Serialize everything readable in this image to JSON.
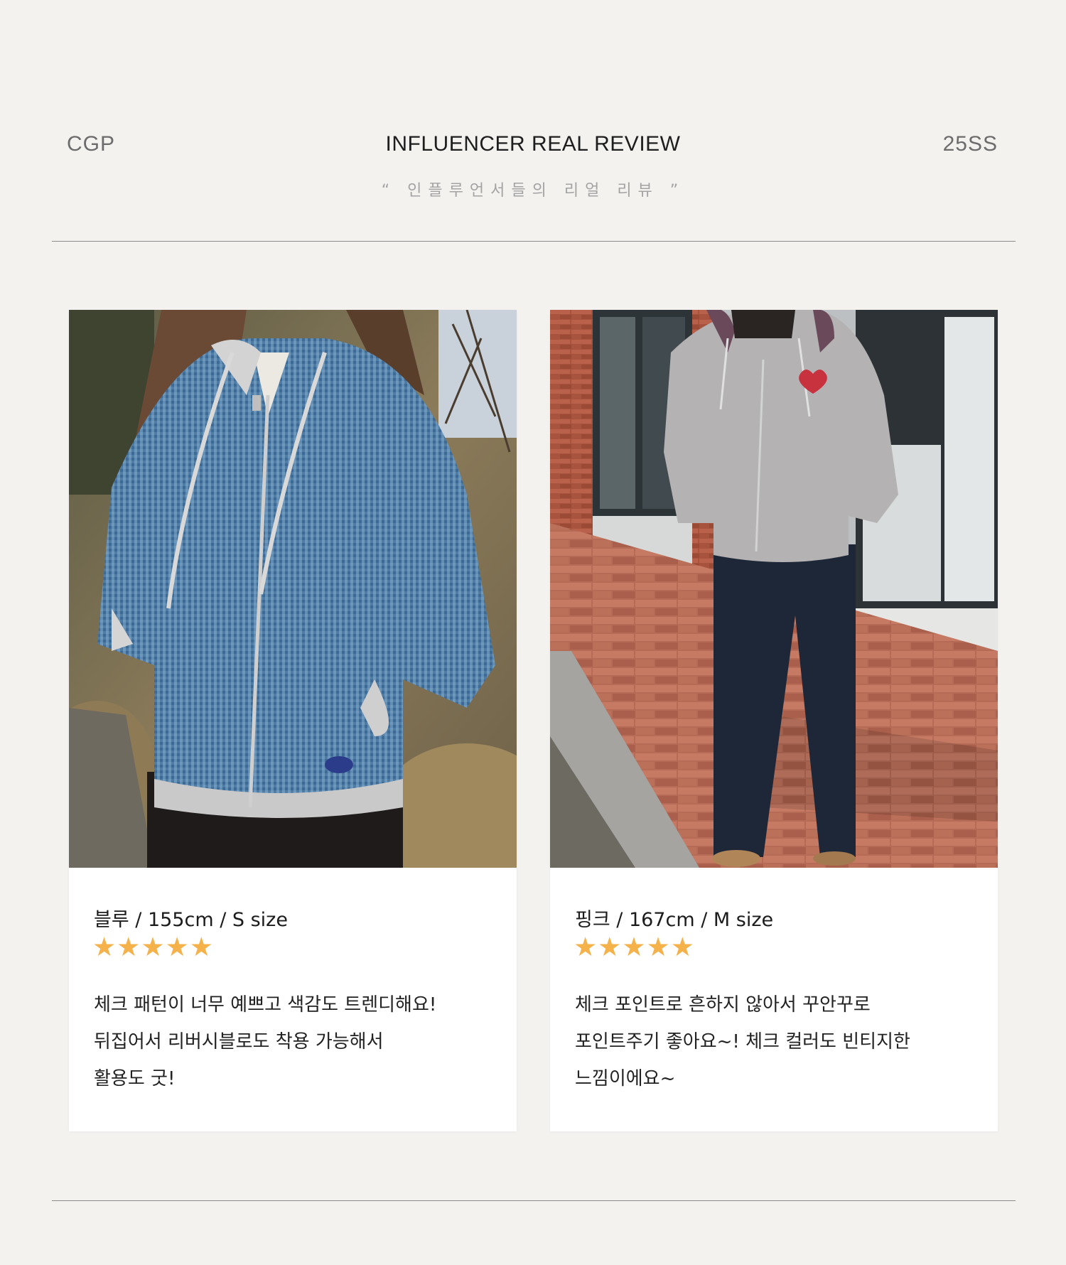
{
  "header": {
    "brand_left": "CGP",
    "title": "INFLUENCER REAL REVIEW",
    "brand_right": "25SS",
    "subtitle": "“ 인플루언서들의 리얼 리뷰 ”"
  },
  "reviews": [
    {
      "photo_alt": "blue gingham reversible zip hoodie worn outdoors",
      "meta": "블루 / 155cm / S size",
      "rating": 5,
      "stars": [
        "★",
        "★",
        "★",
        "★",
        "★"
      ],
      "lines": [
        "체크 패턴이 너무 예쁘고 색감도 트렌디해요!",
        "뒤집어서 리버시블로도 착용 가능해서",
        "활용도 굿!"
      ]
    },
    {
      "photo_alt": "grey zip hoodie with heart patch worn with dark wide jeans on brick sidewalk",
      "meta": "핑크 / 167cm / M size",
      "rating": 5,
      "stars": [
        "★",
        "★",
        "★",
        "★",
        "★"
      ],
      "lines": [
        "체크 포인트로 흔하지 않아서 꾸안꾸로",
        "포인트주기 좋아요~! 체크 컬러도 빈티지한",
        "느낌이에요~"
      ]
    }
  ],
  "colors": {
    "background": "#f3f2ef",
    "star": "#f5b24a",
    "rule": "#8b8b8b"
  }
}
